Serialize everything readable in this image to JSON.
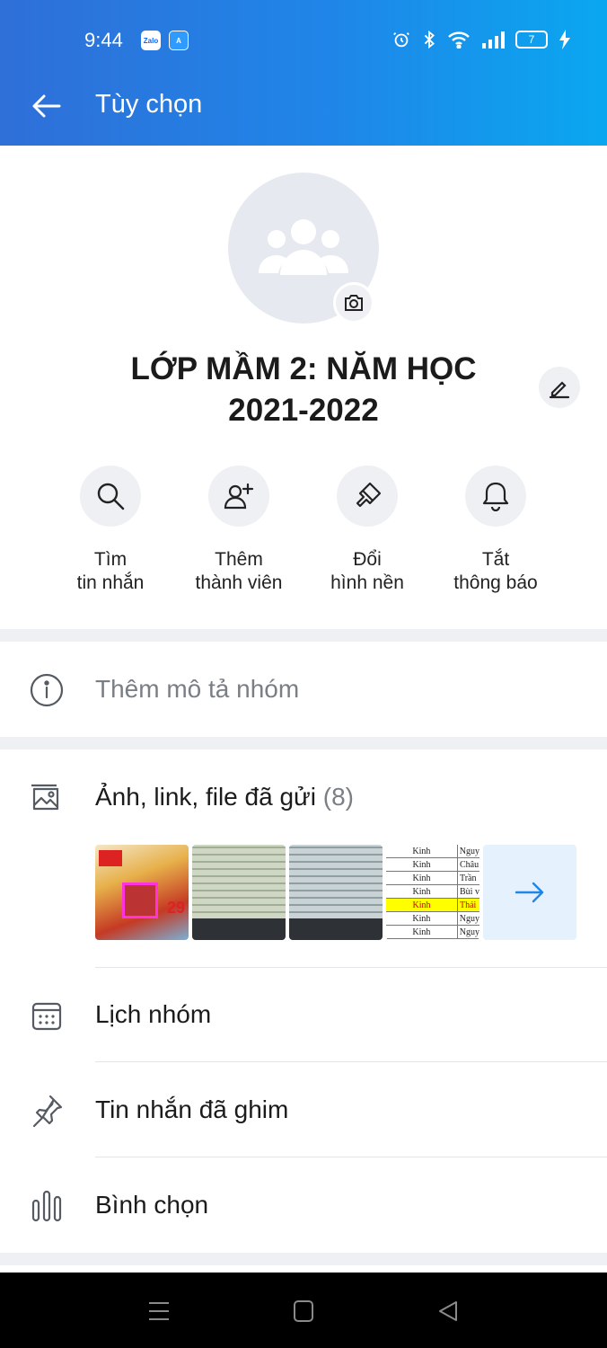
{
  "status_bar": {
    "time": "9:44",
    "app_badges": [
      "Zalo",
      "A"
    ],
    "battery": "7"
  },
  "header": {
    "title": "Tùy chọn"
  },
  "group": {
    "name": "LỚP MẦM 2: NĂM HỌC 2021-2022"
  },
  "actions": [
    {
      "line1": "Tìm",
      "line2": "tin nhắn",
      "icon": "search-icon"
    },
    {
      "line1": "Thêm",
      "line2": "thành viên",
      "icon": "add-user-icon"
    },
    {
      "line1": "Đổi",
      "line2": "hình nền",
      "icon": "paintbrush-icon"
    },
    {
      "line1": "Tắt",
      "line2": "thông báo",
      "icon": "bell-icon"
    }
  ],
  "description_placeholder": "Thêm mô tả nhóm",
  "media": {
    "label": "Ảnh, link, file đã gửi",
    "count": "(8)",
    "thumb_texts": {
      "poster_number": "29",
      "sheet_rows": [
        [
          "Kinh",
          "Nguy"
        ],
        [
          "Kinh",
          "Châu"
        ],
        [
          "Kinh",
          "Trần"
        ],
        [
          "Kinh",
          "Bùi v"
        ],
        [
          "Kinh",
          "Thái"
        ],
        [
          "Kinh",
          "Nguy"
        ],
        [
          "Kinh",
          "Nguy"
        ]
      ]
    }
  },
  "menu": [
    {
      "label": "Lịch nhóm",
      "icon": "calendar-icon"
    },
    {
      "label": "Tin nhắn đã ghim",
      "icon": "pin-icon"
    },
    {
      "label": "Bình chọn",
      "icon": "poll-icon"
    }
  ],
  "colors": {
    "header_gradient_start": "#2f6fd8",
    "header_gradient_end": "#0aa7f0",
    "accent": "#1f86e8",
    "icon_gray": "#555b63"
  }
}
